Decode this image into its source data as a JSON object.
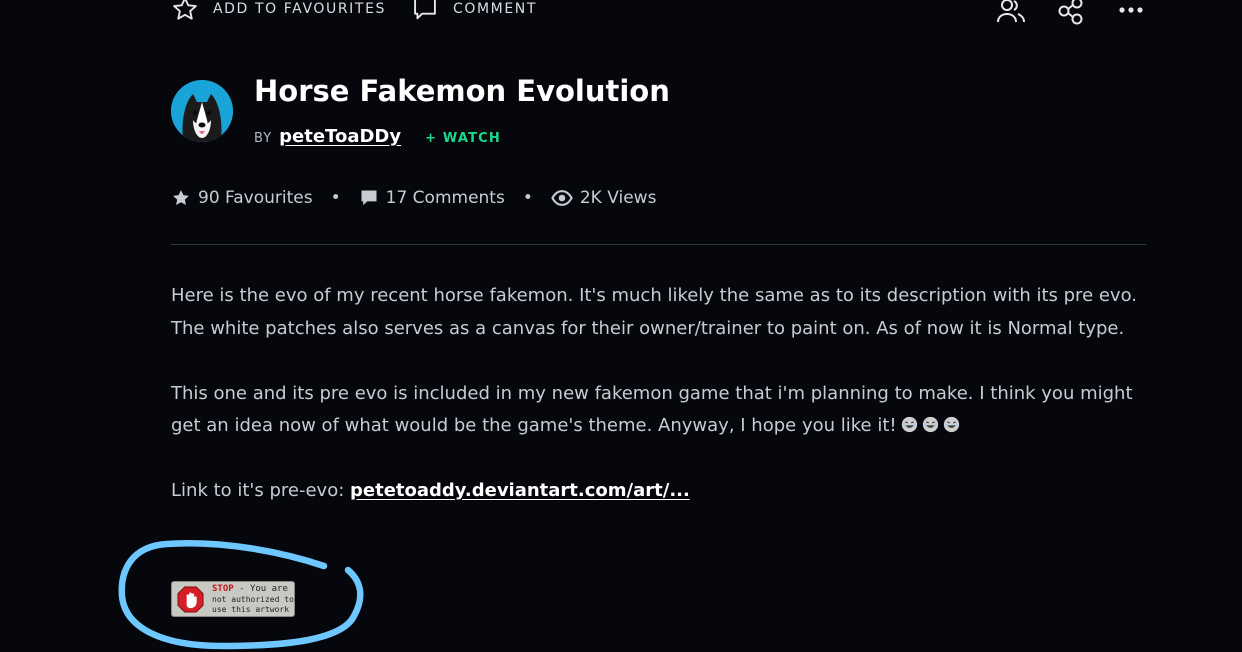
{
  "toolbar": {
    "favourite_label": "ADD TO FAVOURITES",
    "comment_label": "COMMENT",
    "icons": [
      "star-outline-icon",
      "comment-icon",
      "people-icon",
      "share-icon",
      "more-icon"
    ]
  },
  "deviation": {
    "title": "Horse Fakemon Evolution",
    "by_label": "BY",
    "author": "peteToaDDy",
    "watch_label": "+ WATCH"
  },
  "stats": {
    "favourites": "90 Favourites",
    "comments": "17 Comments",
    "views": "2K Views",
    "separator": "•"
  },
  "description": {
    "paragraph1": "Here is the evo of my recent horse fakemon. It's much likely the same as to its description with its pre evo. The white patches also serves as a canvas for their owner/trainer to paint on. As of now it is Normal type.",
    "paragraph2": "This one and its pre evo is included in my new fakemon game that i'm planning to make. I think you might get an idea now of what would be the game's theme. Anyway, I hope you like it!",
    "link_prefix": "Link to it's pre-evo: ",
    "link_text": "petetoaddy.deviantart.com/art/..."
  },
  "stamp": {
    "stop_word": "STOP",
    "line1_rest": " - You are",
    "line2": "not authorized to",
    "line3": "use this artwork"
  },
  "colors": {
    "background": "#06070d",
    "watch": "#1bd88a",
    "annotation_circle": "#6ec8ff",
    "stop_red": "#c4161c"
  }
}
